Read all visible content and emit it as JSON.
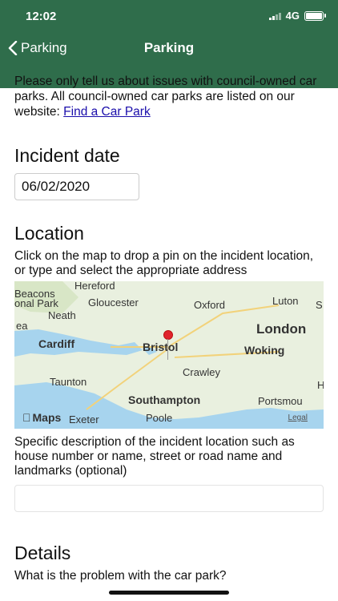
{
  "status_bar": {
    "time": "12:02",
    "network": "4G"
  },
  "nav": {
    "back_label": "Parking",
    "title": "Parking"
  },
  "intro": {
    "text": "Please only tell us about issues with council-owned car parks. All council-owned car parks are listed on our website: ",
    "link_text": "Find a Car Park"
  },
  "incident_date": {
    "label": "Incident date",
    "value": "06/02/2020"
  },
  "location": {
    "label": "Location",
    "help": "Click on the map to drop a pin on the incident location, or type and select the appropriate address",
    "map": {
      "places": [
        "Hereford",
        "Beacons",
        "onal Park",
        "Gloucester",
        "Oxford",
        "Luton",
        "S",
        "ea",
        "Neath",
        "London",
        "Cardiff",
        "Bristol",
        "Woking",
        "Crawley",
        "Taunton",
        "H",
        "Southampton",
        "Portsmou",
        "Exeter",
        "Poole"
      ],
      "brand": "Maps",
      "legal": "Legal"
    },
    "description_help": "Specific description of the incident location such as house number or name, street or road name and landmarks (optional)"
  },
  "details": {
    "label": "Details",
    "question": "What is the problem with the car park?"
  }
}
